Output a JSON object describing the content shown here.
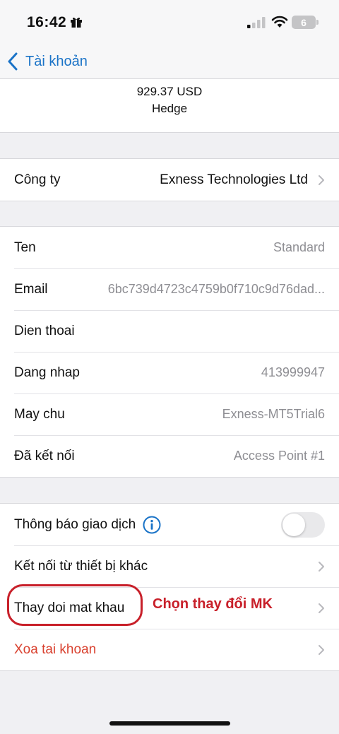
{
  "status_bar": {
    "time": "16:42",
    "battery": "6"
  },
  "nav": {
    "back_label": "Tài khoản"
  },
  "balance": {
    "amount": "929.37 USD",
    "mode": "Hedge"
  },
  "company": {
    "label": "Công ty",
    "value": "Exness Technologies Ltd"
  },
  "details": [
    {
      "label": "Ten",
      "value": "Standard"
    },
    {
      "label": "Email",
      "value": "6bc739d4723c4759b0f710c9d76dad..."
    },
    {
      "label": "Dien thoai",
      "value": ""
    },
    {
      "label": "Dang nhap",
      "value": "413999947"
    },
    {
      "label": "May chu",
      "value": "Exness-MT5Trial6"
    },
    {
      "label": "Đã kết nối",
      "value": "Access Point #1"
    }
  ],
  "actions": {
    "trade_notifications": {
      "label": "Thông báo giao dịch",
      "enabled": false
    },
    "connect_other_device": {
      "label": "Kết nối từ thiết bị khác"
    },
    "change_password": {
      "label": "Thay doi mat khau"
    },
    "delete_account": {
      "label": "Xoa tai khoan"
    }
  },
  "annotation": {
    "text": "Chọn thay đổi MK"
  },
  "colors": {
    "accent": "#1a73c7",
    "danger": "#d9412f",
    "annotation": "#c8202a",
    "background": "#f0f0f3"
  }
}
